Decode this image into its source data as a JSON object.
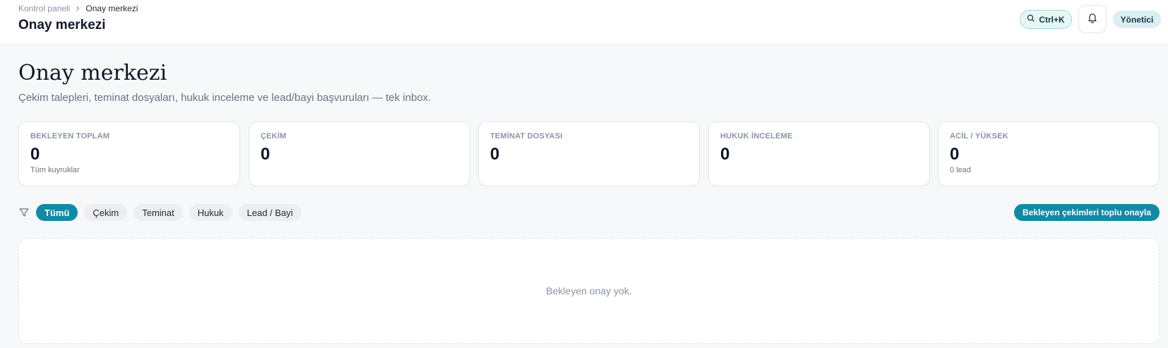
{
  "header": {
    "breadcrumb": [
      {
        "label": "Kontrol paneli"
      },
      {
        "label": "Onay merkezi"
      }
    ],
    "title": "Onay merkezi",
    "search_shortcut": "Ctrl+K",
    "role_label": "Yönetici"
  },
  "page": {
    "title": "Onay merkezi",
    "subtitle": "Çekim talepleri, teminat dosyaları, hukuk inceleme ve lead/bayi başvuruları — tek inbox."
  },
  "stats": [
    {
      "label": "BEKLEYEN TOPLAM",
      "value": "0",
      "sub": "Tüm kuyruklar"
    },
    {
      "label": "ÇEKİM",
      "value": "0",
      "sub": ""
    },
    {
      "label": "TEMİNAT DOSYASI",
      "value": "0",
      "sub": ""
    },
    {
      "label": "HUKUK İNCELEME",
      "value": "0",
      "sub": ""
    },
    {
      "label": "ACİL / YÜKSEK",
      "value": "0",
      "sub": "0 lead"
    }
  ],
  "filters": [
    {
      "label": "Tümü",
      "active": true
    },
    {
      "label": "Çekim",
      "active": false
    },
    {
      "label": "Teminat",
      "active": false
    },
    {
      "label": "Hukuk",
      "active": false
    },
    {
      "label": "Lead / Bayi",
      "active": false
    }
  ],
  "bulk_action_label": "Bekleyen çekimleri toplu onayla",
  "empty_state": "Bekleyen onay yok.",
  "colors": {
    "accent": "#118aa6",
    "search_pill_bg": "#e7f7f6",
    "role_pill_bg": "#dbeef2"
  },
  "icons": [
    "search-icon",
    "bell-icon",
    "chevron-right-icon",
    "filter-icon"
  ]
}
